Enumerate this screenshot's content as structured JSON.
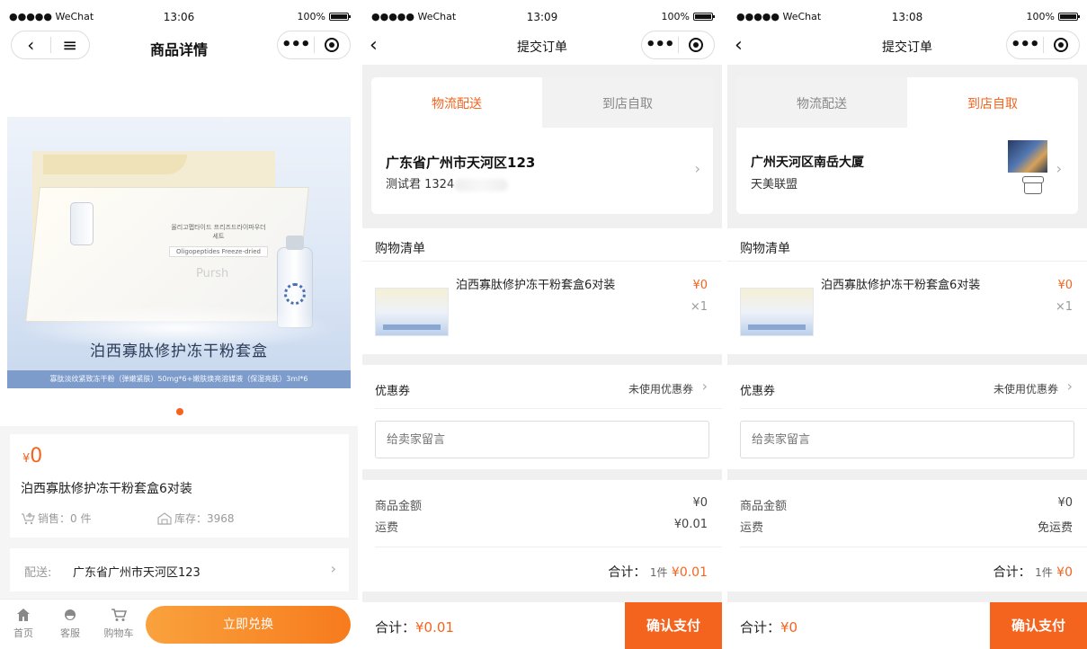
{
  "status": {
    "p1": {
      "carrier": "●●●●● WeChat",
      "time": "13:06",
      "battery": "100%"
    },
    "p2": {
      "carrier": "●●●●● WeChat",
      "time": "13:09",
      "battery": "100%"
    },
    "p3": {
      "carrier": "●●●●● WeChat",
      "time": "13:08",
      "battery": "100%"
    }
  },
  "product_page": {
    "nav_title": "商品详情",
    "banner_title": "泊西寡肽修护冻干粉套盒",
    "banner_sub": "寡肽淡纹紧致冻干粉（弹嫩紧肤）50mg*6+嫩肤焕亮溶媒液（保湿亮肤）3ml*6",
    "box_text": "올리고펩타이드 프리즈드라이파우더 세트",
    "box_sub": "Oligopeptides Freeze-dried",
    "box_brand": "Pursh",
    "currency": "¥",
    "price": "0",
    "product_name": "泊西寡肽修护冻干粉套盒6对装",
    "sold": "销售：0 件",
    "stock": "库存：3968",
    "ship_label": "配送:",
    "ship_address": "广东省广州市天河区123",
    "tabs": [
      {
        "label": "首页",
        "icon": "home-icon"
      },
      {
        "label": "客服",
        "icon": "service-icon"
      },
      {
        "label": "购物车",
        "icon": "cart-icon"
      }
    ],
    "exchange_button": "立即兑换",
    "accent": "#f5641e"
  },
  "order_delivery": {
    "nav_title": "提交订单",
    "tab_logistics": "物流配送",
    "tab_pickup": "到店自取",
    "address": "广东省广州市天河区123",
    "contact": "测试君 1324",
    "cart_title": "购物清单",
    "item_name": "泊西寡肽修护冻干粉套盒6对装",
    "item_price": "¥0",
    "item_qty": "×1",
    "coupon_label": "优惠券",
    "coupon_value": "未使用优惠券",
    "message_placeholder": "给卖家留言",
    "goods_amount_label": "商品金额",
    "goods_amount": "¥0",
    "freight_label": "运费",
    "freight": "¥0.01",
    "sum_label": "合计：",
    "sum_count": "1件",
    "sum_amount": "¥0.01",
    "pay_total_label": "合计：",
    "pay_total": "¥0.01",
    "pay_button": "确认支付"
  },
  "order_pickup": {
    "nav_title": "提交订单",
    "tab_logistics": "物流配送",
    "tab_pickup": "到店自取",
    "store_address": "广州天河区南岳大厦",
    "store_name": "天美联盟",
    "cart_title": "购物清单",
    "item_name": "泊西寡肽修护冻干粉套盒6对装",
    "item_price": "¥0",
    "item_qty": "×1",
    "coupon_label": "优惠券",
    "coupon_value": "未使用优惠券",
    "message_placeholder": "给卖家留言",
    "goods_amount_label": "商品金额",
    "goods_amount": "¥0",
    "freight_label": "运费",
    "freight": "免运费",
    "sum_label": "合计：",
    "sum_count": "1件",
    "sum_amount": "¥0",
    "pay_total_label": "合计：",
    "pay_total": "¥0",
    "pay_button": "确认支付"
  }
}
